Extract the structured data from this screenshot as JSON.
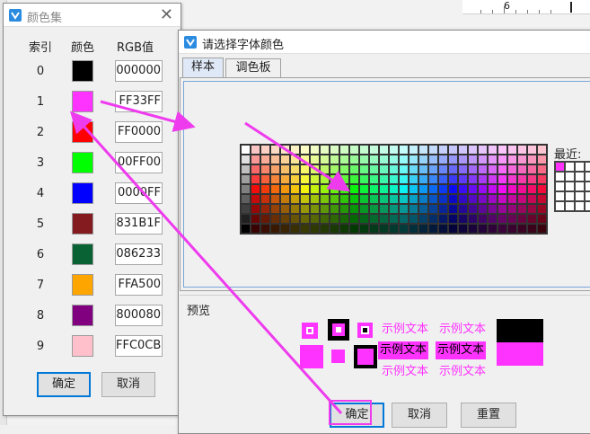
{
  "background": {
    "ruler_number": "6"
  },
  "color_set": {
    "title": "颜色集",
    "close_glyph": "✕",
    "headers": {
      "index": "索引",
      "color": "颜色",
      "rgb": "RGB值"
    },
    "rows": [
      {
        "index": "0",
        "color": "#000000",
        "rgb": "000000"
      },
      {
        "index": "1",
        "color": "#FF33FF",
        "rgb": "FF33FF"
      },
      {
        "index": "2",
        "color": "#FF0000",
        "rgb": "FF0000"
      },
      {
        "index": "3",
        "color": "#00FF00",
        "rgb": "00FF00"
      },
      {
        "index": "4",
        "color": "#0000FF",
        "rgb": "0000FF"
      },
      {
        "index": "5",
        "color": "#831B1F",
        "rgb": "831B1F"
      },
      {
        "index": "6",
        "color": "#086233",
        "rgb": "086233"
      },
      {
        "index": "7",
        "color": "#FFA500",
        "rgb": "FFA500"
      },
      {
        "index": "8",
        "color": "#800080",
        "rgb": "800080"
      },
      {
        "index": "9",
        "color": "#FFC0CB",
        "rgb": "FFC0CB"
      }
    ],
    "ok_label": "确定",
    "cancel_label": "取消"
  },
  "font_color": {
    "title": "请选择字体颜色",
    "tabs": [
      {
        "label": "样本"
      },
      {
        "label": "调色板"
      }
    ],
    "recent_label": "最近:",
    "preview_label": "预览",
    "sample_text": "示例文本",
    "selected_color": "#FF33FF",
    "ok_label": "确定",
    "cancel_label": "取消",
    "reset_label": "重置"
  },
  "colors": {
    "annotation_arrow": "#EE3BEE",
    "active_border": "#0078D7"
  }
}
